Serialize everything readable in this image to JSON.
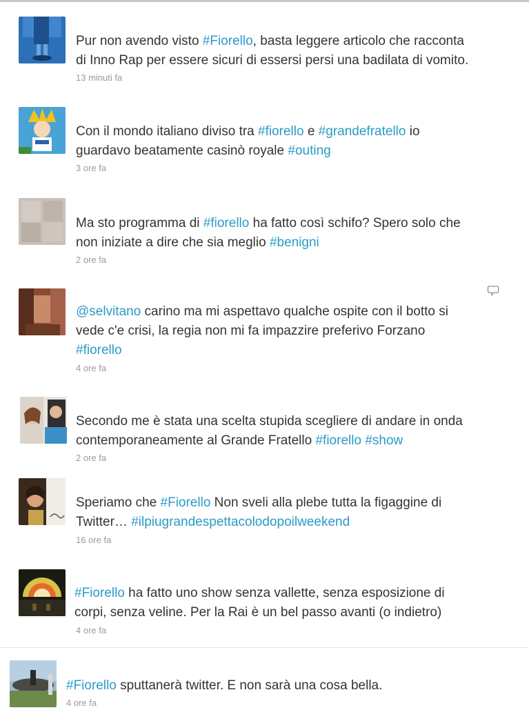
{
  "tweets": [
    {
      "lines": [
        [
          {
            "t": "Pur non avendo visto "
          },
          {
            "t": "#Fiorello",
            "h": true
          },
          {
            "t": ", basta leggere articolo che racconta"
          }
        ],
        [
          {
            "t": "di Inno Rap per essere sicuri di essersi persi una badilata di vomito."
          }
        ]
      ],
      "time": "13 minuti fa"
    },
    {
      "lines": [
        [
          {
            "t": "Con il mondo italiano diviso tra "
          },
          {
            "t": "#fiorello",
            "h": true
          },
          {
            "t": " e "
          },
          {
            "t": "#grandefratello",
            "h": true
          },
          {
            "t": " io"
          }
        ],
        [
          {
            "t": "guardavo beatamente casinò royale "
          },
          {
            "t": "#outing",
            "h": true
          }
        ]
      ],
      "time": "3 ore fa"
    },
    {
      "lines": [
        [
          {
            "t": "Ma sto programma di "
          },
          {
            "t": "#fiorello",
            "h": true
          },
          {
            "t": " ha fatto così schifo? Spero solo che"
          }
        ],
        [
          {
            "t": "non iniziate a dire che sia meglio "
          },
          {
            "t": "#benigni",
            "h": true
          }
        ]
      ],
      "time": "2 ore fa"
    },
    {
      "lines": [
        [
          {
            "t": "@selvitano",
            "h": true
          },
          {
            "t": " carino ma mi aspettavo qualche ospite con il botto si"
          }
        ],
        [
          {
            "t": "vede c'e crisi, la regia non mi fa impazzire preferivo Forzano"
          }
        ],
        [
          {
            "t": "#fiorello",
            "h": true
          }
        ]
      ],
      "time": "4 ore fa"
    },
    {
      "lines": [
        [
          {
            "t": "Secondo me è stata una scelta stupida scegliere di andare in onda"
          }
        ],
        [
          {
            "t": "contemporaneamente al Grande Fratello "
          },
          {
            "t": "#fiorello",
            "h": true
          },
          {
            "t": " "
          },
          {
            "t": "#show",
            "h": true
          }
        ]
      ],
      "time": "2 ore fa"
    },
    {
      "lines": [
        [
          {
            "t": "Speriamo che "
          },
          {
            "t": "#Fiorello",
            "h": true
          },
          {
            "t": " Non sveli alla plebe tutta la figaggine di"
          }
        ],
        [
          {
            "t": "Twitter… "
          },
          {
            "t": "#ilpiugrandespettacolodopoilweekend",
            "h": true
          }
        ]
      ],
      "time": "16 ore fa"
    },
    {
      "lines": [
        [
          {
            "t": "#Fiorello",
            "h": true
          },
          {
            "t": " ha fatto uno show senza vallette, senza esposizione di"
          }
        ],
        [
          {
            "t": "corpi, senza veline. Per la Rai è un bel passo avanti (o indietro)"
          }
        ]
      ],
      "time": "4 ore fa"
    },
    {
      "lines": [
        [
          {
            "t": "#Fiorello",
            "h": true
          },
          {
            "t": " sputtanerà twitter. E non sarà una cosa bella."
          }
        ]
      ],
      "time": "4 ore fa"
    }
  ],
  "icons": {
    "reply": "reply-speech-bubble-icon"
  },
  "colors": {
    "hashtag": "#2a9bc7",
    "text": "#333333",
    "time": "#9a9a9a"
  }
}
